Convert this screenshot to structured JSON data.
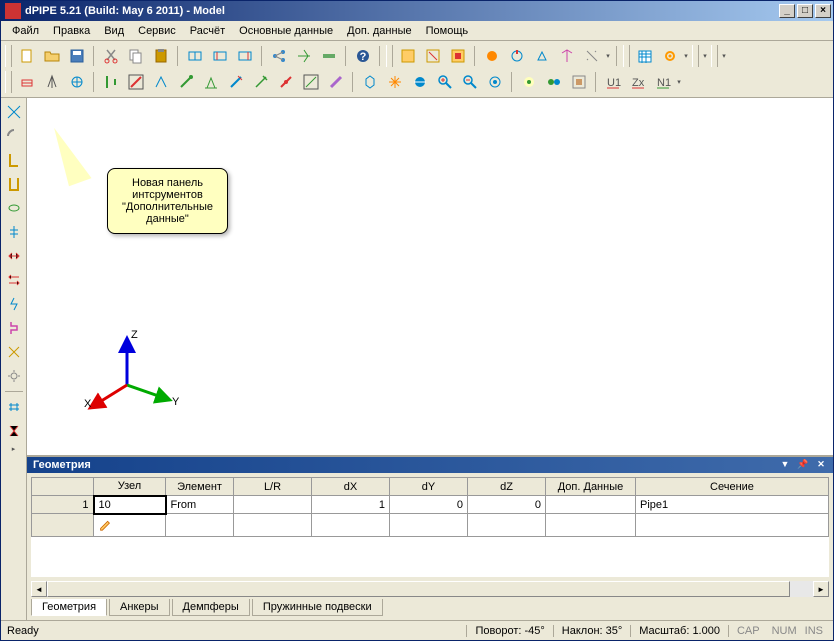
{
  "window": {
    "title": "dPIPE 5.21 (Build: May  6 2011) - Model"
  },
  "menu": {
    "items": [
      "Файл",
      "Правка",
      "Вид",
      "Сервис",
      "Расчёт",
      "Основные данные",
      "Доп. данные",
      "Помощь"
    ]
  },
  "callout": {
    "line1": "Новая панель",
    "line2": "интсрументов",
    "line3": "\"Дополнительные",
    "line4": "данные\""
  },
  "axes": {
    "x": "X",
    "y": "Y",
    "z": "Z"
  },
  "panel": {
    "title": "Геометрия",
    "columns": [
      "",
      "Узел",
      "Элемент",
      "L/R",
      "dX",
      "dY",
      "dZ",
      "Доп. Данные",
      "Сечение"
    ],
    "rows": [
      {
        "idx": "1",
        "node": "10",
        "elem": "From",
        "lr": "",
        "dx": "1",
        "dy": "0",
        "dz": "0",
        "extra": "",
        "section": "Pipe1"
      }
    ],
    "tabs": [
      "Геометрия",
      "Анкеры",
      "Демпферы",
      "Пружинные подвески"
    ],
    "active_tab": 0
  },
  "status": {
    "ready": "Ready",
    "rotate": "Поворот: -45°",
    "tilt": "Наклон: 35°",
    "scale": "Масштаб: 1.000",
    "cap": "CAP",
    "num": "NUM",
    "ins": "INS"
  }
}
